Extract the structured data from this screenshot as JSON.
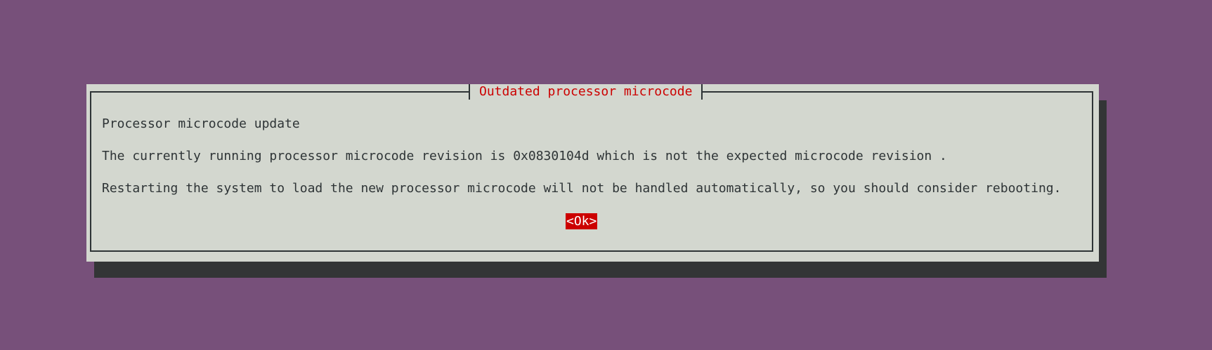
{
  "dialog": {
    "title": "Outdated processor microcode",
    "lines": [
      "Processor microcode update",
      "The currently running processor microcode revision is 0x0830104d which is not the expected microcode revision .",
      "Restarting the system to load the new processor microcode will not be handled automatically, so you should consider rebooting."
    ],
    "ok_label": "<Ok>"
  },
  "colors": {
    "background": "#77507a",
    "dialog_bg": "#d3d7cf",
    "shadow": "#333536",
    "title_text": "#cc0000",
    "button_bg": "#cc0000",
    "button_text": "#ffffff",
    "body_text": "#2e3436"
  }
}
